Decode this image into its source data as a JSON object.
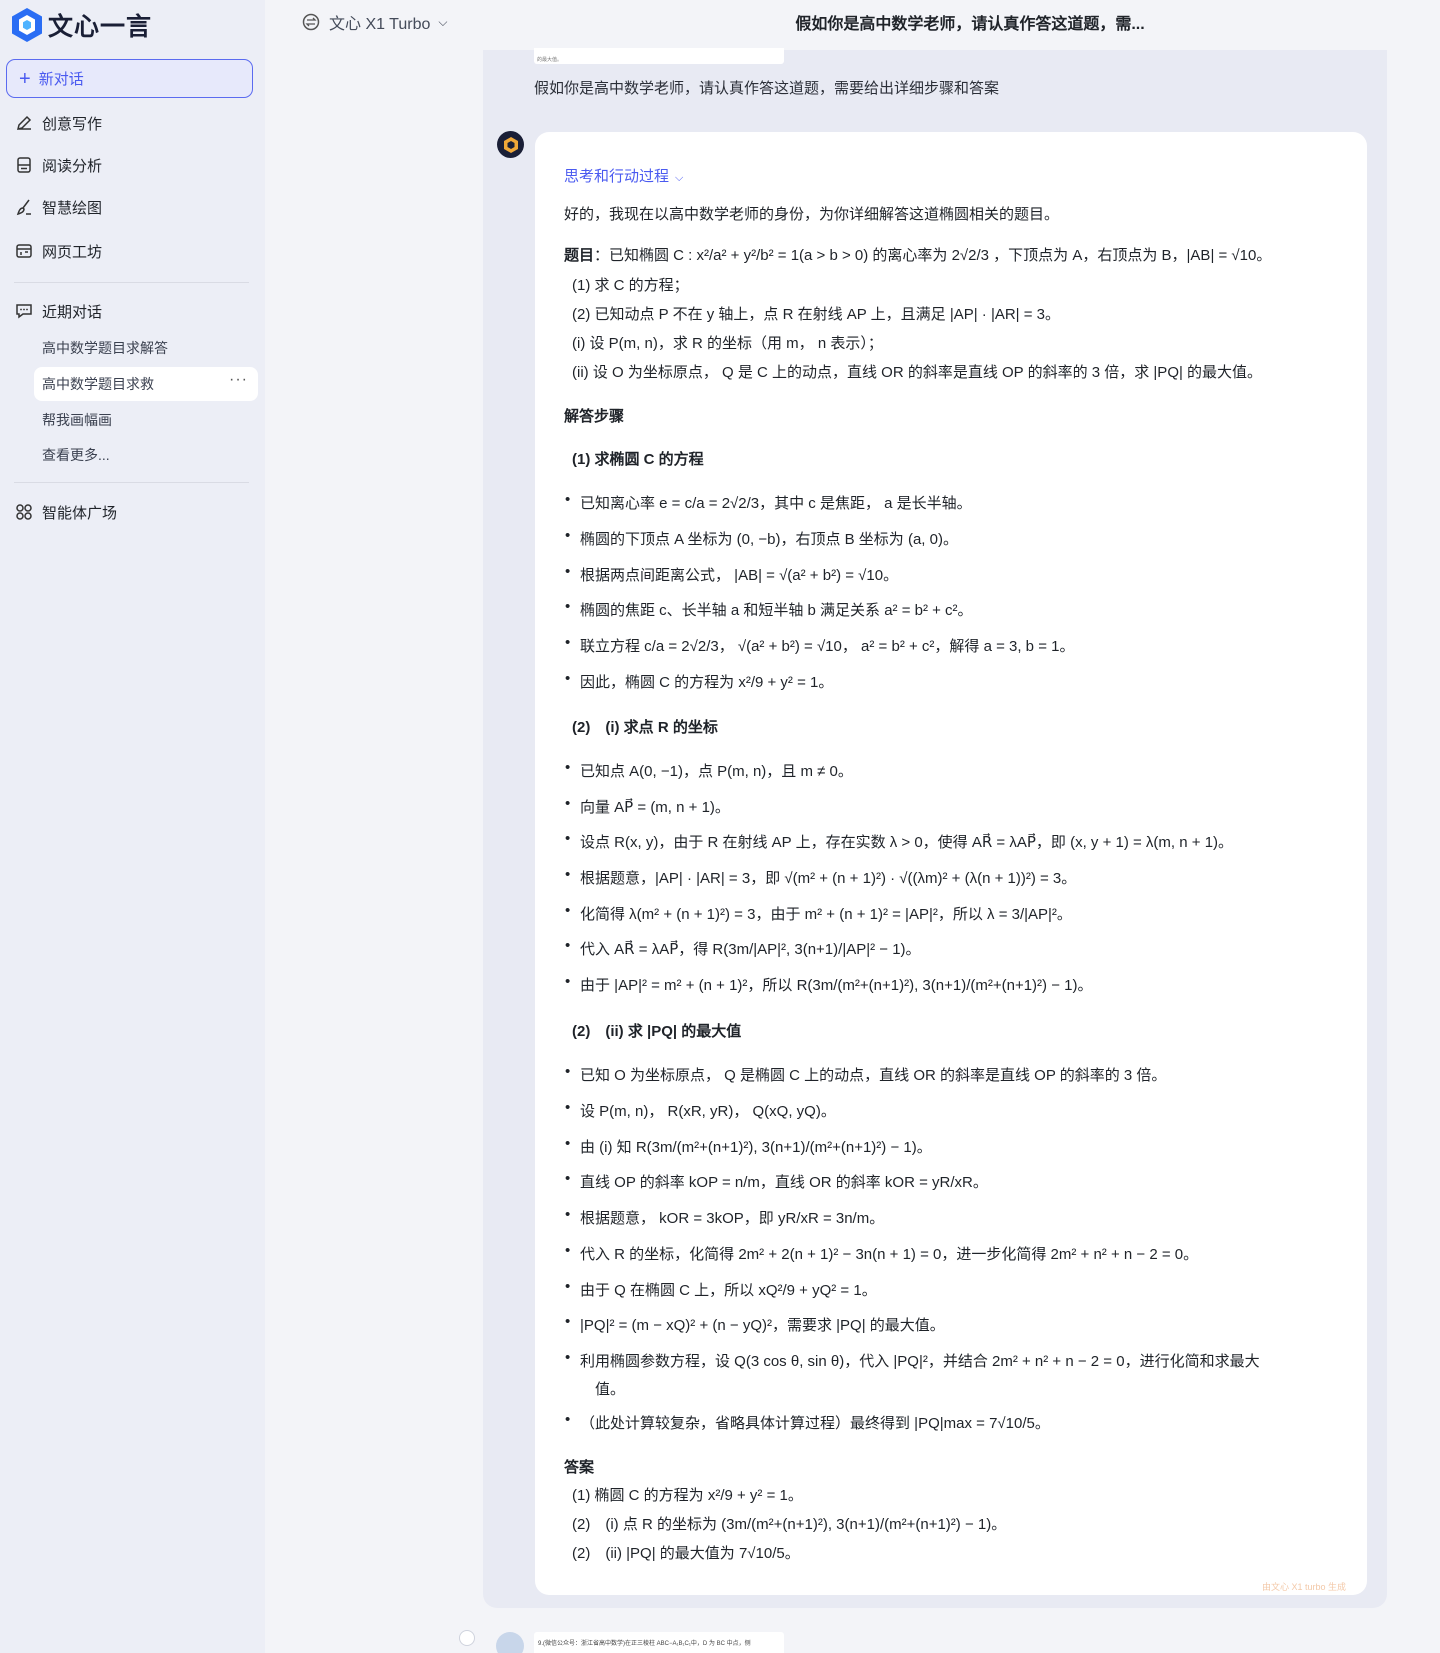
{
  "app": {
    "name": "文心一言",
    "brand_color": "#4a5af0"
  },
  "sidebar": {
    "new_chat": "新对话",
    "nav": [
      {
        "label": "创意写作",
        "icon": "pen-icon"
      },
      {
        "label": "阅读分析",
        "icon": "document-icon"
      },
      {
        "label": "智慧绘图",
        "icon": "brush-icon"
      },
      {
        "label": "网页工坊",
        "icon": "webpage-icon"
      }
    ],
    "recent_header": "近期对话",
    "recent": [
      "高中数学题目求解答",
      "高中数学题目求救",
      "帮我画幅画"
    ],
    "view_more": "查看更多...",
    "agents": "智能体广场",
    "more_dots": "···"
  },
  "header": {
    "model": "文心 X1 Turbo",
    "title": "假如你是高中数学老师，请认真作答这道题，需..."
  },
  "conversation": {
    "user_message": "假如你是高中数学老师，请认真作答这道题，需要给出详细步骤和答案",
    "image_caption": "的最大值。",
    "think_label": "思考和行动过程",
    "intro": "好的，我现在以高中数学老师的身份，为你详细解答这道椭圆相关的题目。",
    "problem_label": "题目",
    "problem_text": "：已知椭圆 C : x²/a² + y²/b² = 1(a > b > 0) 的离心率为 2√2/3 ，下顶点为 A，右顶点为 B，|AB| = √10。",
    "problem_items": [
      "(1) 求 C 的方程；",
      "(2) 已知动点 P 不在 y 轴上，点 R 在射线 AP 上，且满足 |AP| · |AR| = 3。",
      "(i) 设 P(m, n)，求 R 的坐标（用 m， n 表示）；",
      "(ii) 设 O 为坐标原点， Q 是 C 上的动点，直线 OR 的斜率是直线 OP 的斜率的 3 倍，求 |PQ| 的最大值。"
    ],
    "steps_label": "解答步骤",
    "sec1_title": "(1) 求椭圆 C 的方程",
    "sec1_bullets": [
      "已知离心率 e = c/a = 2√2/3，其中 c 是焦距， a 是长半轴。",
      "椭圆的下顶点 A 坐标为 (0, −b)，右顶点 B 坐标为 (a, 0)。",
      "根据两点间距离公式， |AB| = √(a² + b²) = √10。",
      "椭圆的焦距 c、长半轴 a 和短半轴 b 满足关系 a² = b² + c²。",
      "联立方程 c/a = 2√2/3， √(a² + b²) = √10， a² = b² + c²，解得 a = 3, b = 1。",
      "因此，椭圆 C 的方程为 x²/9 + y² = 1。"
    ],
    "sec2_title": "(2)　(i) 求点 R 的坐标",
    "sec2_bullets": [
      "已知点 A(0, −1)，点 P(m, n)，且 m ≠ 0。",
      "向量 AP⃗ = (m, n + 1)。",
      "设点 R(x, y)，由于 R 在射线 AP 上，存在实数 λ > 0，使得 AR⃗ = λAP⃗，即 (x, y + 1) = λ(m, n + 1)。",
      "根据题意，|AP| · |AR| = 3，即 √(m² + (n + 1)²) · √((λm)² + (λ(n + 1))²) = 3。",
      "化简得 λ(m² + (n + 1)²) = 3，由于 m² + (n + 1)² = |AP|²，所以 λ = 3/|AP|²。",
      "代入 AR⃗ = λAP⃗，得 R(3m/|AP|², 3(n+1)/|AP|² − 1)。",
      "由于 |AP|² = m² + (n + 1)²，所以 R(3m/(m²+(n+1)²), 3(n+1)/(m²+(n+1)²) − 1)。"
    ],
    "sec3_title": "(2)　(ii) 求 |PQ| 的最大值",
    "sec3_bullets": [
      "已知 O 为坐标原点， Q 是椭圆 C 上的动点，直线 OR 的斜率是直线 OP 的斜率的 3 倍。",
      "设 P(m, n)， R(xR, yR)， Q(xQ, yQ)。",
      "由 (i) 知 R(3m/(m²+(n+1)²), 3(n+1)/(m²+(n+1)²) − 1)。",
      "直线 OP 的斜率 kOP = n/m，直线 OR 的斜率 kOR = yR/xR。",
      "根据题意， kOR = 3kOP，即 yR/xR = 3n/m。",
      "代入 R 的坐标，化简得 2m² + 2(n + 1)² − 3n(n + 1) = 0，进一步化简得 2m² + n² + n − 2 = 0。",
      "由于 Q 在椭圆 C 上，所以 xQ²/9 + yQ² = 1。",
      "|PQ|² = (m − xQ)² + (n − yQ)²，需要求 |PQ| 的最大值。",
      "利用椭圆参数方程，设 Q(3 cos θ, sin θ)，代入 |PQ|²，并结合 2m² + n² + n − 2 = 0，进行化简和求最大",
      "（此处计算较复杂，省略具体计算过程）最终得到 |PQ|max = 7√10/5。"
    ],
    "sec3_wrap": "值。",
    "answer_label": "答案",
    "answers": [
      "(1) 椭圆 C 的方程为 x²/9 + y² = 1。",
      "(2)　(i) 点 R 的坐标为 (3m/(m²+(n+1)²), 3(n+1)/(m²+(n+1)²) − 1)。",
      "(2)　(ii) |PQ| 的最大值为 7√10/5。"
    ],
    "watermark": "由文心 X1 turbo 生成",
    "next_image_caption": "9.(微信公众号：浙江省高中数学)在正三棱柱 ABC−A₁B₁C₁中，D 为 BC 中点，侧"
  }
}
